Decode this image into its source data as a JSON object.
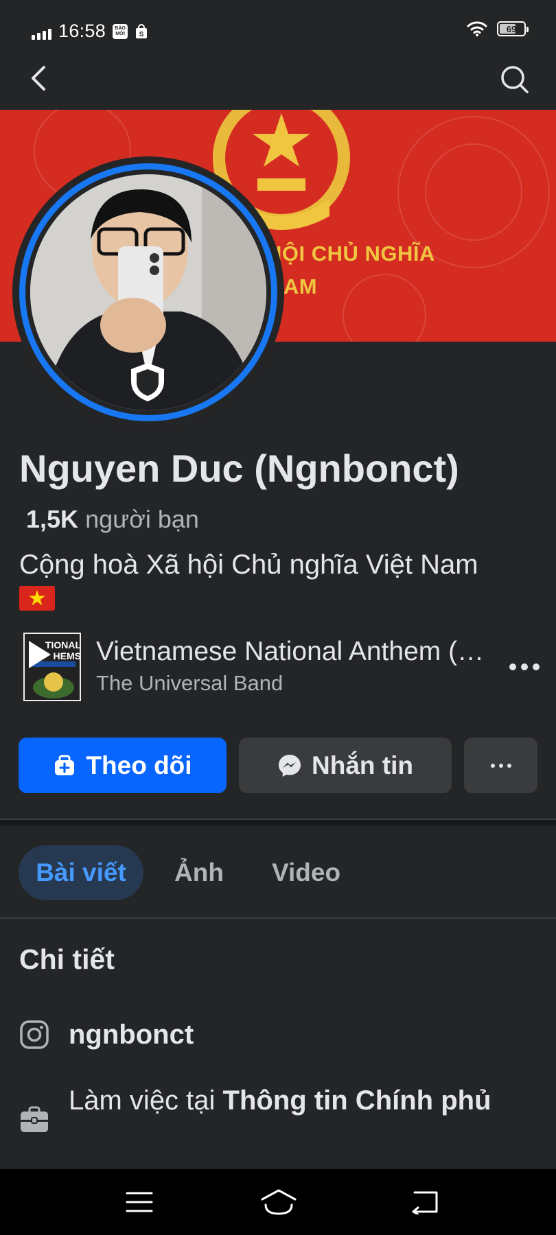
{
  "status_bar": {
    "time": "16:58",
    "badge_text": "BÁO MỚI",
    "battery": "69",
    "battery_level": 0.69,
    "icons": [
      "signal-icon",
      "news-app-icon",
      "shopping-bag-icon",
      "wifi-icon",
      "battery-icon"
    ]
  },
  "nav": {
    "icons": [
      "back-arrow-icon",
      "search-icon"
    ]
  },
  "cover": {
    "line1": "HỘI CHỦ NGHĨA",
    "line2": "NAM",
    "colors": {
      "background": "#d52c22",
      "emblem": "#f0c640"
    }
  },
  "profile": {
    "name": "Nguyen Duc (Ngnbonct)",
    "friends_count": "1,5K",
    "friends_label": "người bạn",
    "bio": "Cộng hoà Xã hội Chủ nghĩa Việt Nam",
    "bio_emoji": "vietnam-flag-icon"
  },
  "music": {
    "cover_text": "TIONAL HEMS",
    "title": "Vietnamese National Anthem (…",
    "artist": "The Universal Band"
  },
  "actions": {
    "follow": "Theo dõi",
    "message": "Nhắn tin"
  },
  "tabs": [
    {
      "label": "Bài viết",
      "active": true
    },
    {
      "label": "Ảnh",
      "active": false
    },
    {
      "label": "Video",
      "active": false
    }
  ],
  "details": {
    "title": "Chi tiết",
    "instagram": "ngnbonct",
    "work_prefix": "Làm việc tại",
    "work_place": "Thông tin Chính phủ"
  },
  "colors": {
    "accent": "#0866ff",
    "ring": "#1877f2",
    "background": "#242526",
    "secondary_button": "#3a3b3c",
    "active_tab_bg": "#263951",
    "active_tab_text": "#4599ff"
  }
}
